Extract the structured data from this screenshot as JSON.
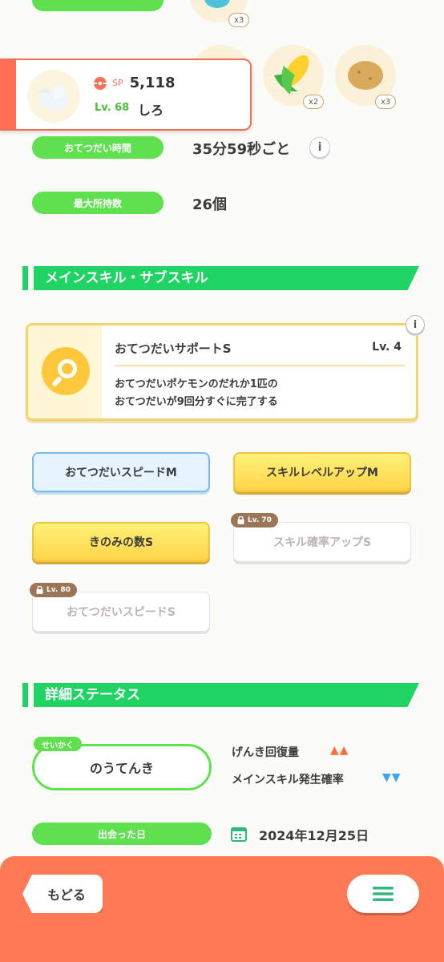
{
  "card": {
    "sp_label": "SP",
    "sp_value": "5,118",
    "level_label": "Lv. 68",
    "name": "しろ"
  },
  "items": [
    {
      "icon": "fish-icon",
      "count": "x3"
    },
    {
      "icon": "corn-icon",
      "count": "x2"
    },
    {
      "icon": "potato-icon",
      "count": "x3"
    }
  ],
  "stats": {
    "help_time_label": "おてつだい時間",
    "help_time_value": "35分59秒ごと",
    "max_carry_label": "最大所持数",
    "max_carry_value": "26個"
  },
  "skills_section": {
    "title": "メインスキル・サブスキル",
    "main_skill": {
      "name": "おてつだいサポートS",
      "level": "Lv. 4",
      "desc_line1": "おてつだいポケモンのだれか1匹の",
      "desc_line2": "おてつだいが9回分すぐに完了する"
    },
    "subskills": [
      {
        "label": "おてつだいスピードM",
        "style": "blue"
      },
      {
        "label": "スキルレベルアップM",
        "style": "yellow"
      },
      {
        "label": "きのみの数S",
        "style": "yellow"
      },
      {
        "label": "スキル確率アップS",
        "style": "locked",
        "lock": "Lv. 70"
      },
      {
        "label": "おてつだいスピードS",
        "style": "locked",
        "lock": "Lv. 80"
      }
    ]
  },
  "details_section": {
    "title": "詳細ステータス",
    "nature_tag": "せいかく",
    "nature": "のうてんき",
    "up_label": "げんき回復量",
    "up_marks": "▲▲",
    "down_label": "メインスキル発生確率",
    "down_marks": "▼▼",
    "met_label": "出会った日",
    "met_date": "2024年12月25日"
  },
  "footer": {
    "back_label": "もどる"
  },
  "colors": {
    "green": "#5fe04e",
    "section_green": "#20d464",
    "orange": "#ff7a55",
    "up_red": "#ff6b3d",
    "down_blue": "#3aa7f0"
  }
}
